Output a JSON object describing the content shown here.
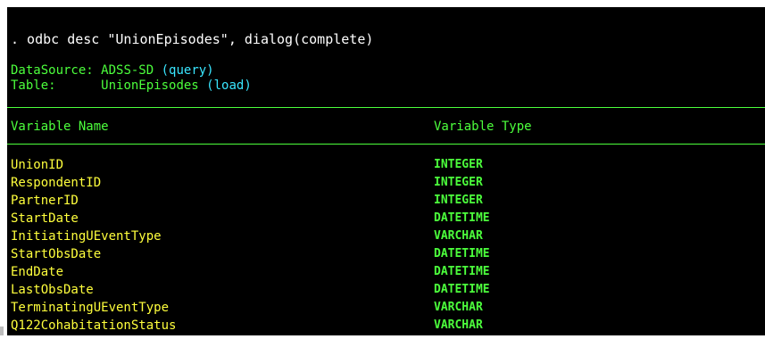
{
  "command": ". odbc desc \"UnionEpisodes\", dialog(complete)",
  "datasource": {
    "label": "DataSource:",
    "name": "ADSS-SD",
    "action": "(query)"
  },
  "table": {
    "label": "Table:",
    "name": "UnionEpisodes",
    "action": "(load)"
  },
  "headers": {
    "name": "Variable Name",
    "type": "Variable Type"
  },
  "variables": [
    {
      "name": "UnionID",
      "type": "INTEGER"
    },
    {
      "name": "RespondentID",
      "type": "INTEGER"
    },
    {
      "name": "PartnerID",
      "type": "INTEGER"
    },
    {
      "name": "StartDate",
      "type": "DATETIME"
    },
    {
      "name": "InitiatingUEventType",
      "type": "VARCHAR"
    },
    {
      "name": "StartObsDate",
      "type": "DATETIME"
    },
    {
      "name": "EndDate",
      "type": "DATETIME"
    },
    {
      "name": "LastObsDate",
      "type": "DATETIME"
    },
    {
      "name": "TerminatingUEventType",
      "type": "VARCHAR"
    },
    {
      "name": "Q122CohabitationStatus",
      "type": "VARCHAR"
    }
  ],
  "colors": {
    "background": "#000000",
    "command_text": "#ffffff",
    "green": "#4cff3c",
    "cyan": "#39e6ff",
    "yellow": "#ffff3c"
  }
}
